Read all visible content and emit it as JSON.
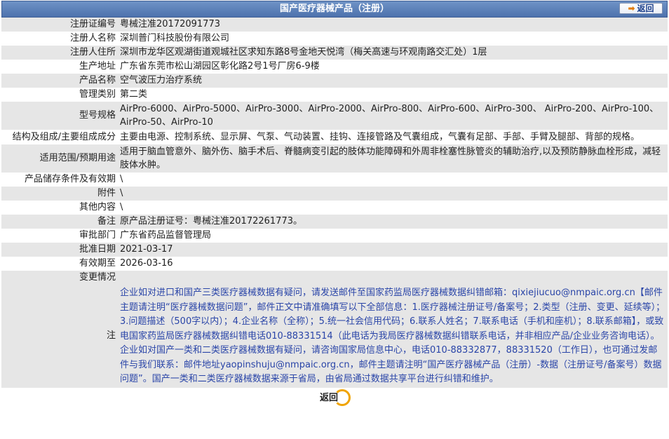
{
  "header": {
    "title": "国产医疗器械产品（注册）",
    "back_label": "返回"
  },
  "rows": [
    {
      "label": "注册证编号",
      "value": "粤械注准20172091773"
    },
    {
      "label": "注册人名称",
      "value": "深圳普门科技股份有限公司"
    },
    {
      "label": "注册人住所",
      "value": "深圳市龙华区观湖街道观城社区求知东路8号金地天悦湾（梅关高速与环观南路交汇处）1层"
    },
    {
      "label": "生产地址",
      "value": "广东省东莞市松山湖园区彰化路2号1号厂房6-9楼"
    },
    {
      "label": "产品名称",
      "value": "空气波压力治疗系统"
    },
    {
      "label": "管理类别",
      "value": "第二类"
    },
    {
      "label": "型号规格",
      "value": "AirPro-6000、AirPro-5000、AirPro-3000、AirPro-2000、AirPro-800、AirPro-600、AirPro-300、 AirPro-200、AirPro-100、AirPro-50、AirPro-10"
    },
    {
      "label": "结构及组成/主要组成成分",
      "value": "主要由电源、控制系统、显示屏、气泵、气动装置、挂钩、连接管路及气囊组成，气囊有足部、手部、手臂及腿部、背部的规格。"
    },
    {
      "label": "适用范围/预期用途",
      "value": "适用于脑血管意外、脑外伤、脑手术后、脊髓病变引起的肢体功能障碍和外周非栓塞性脉管炎的辅助治疗,以及预防静脉血栓形成，减轻肢体水肿。"
    },
    {
      "label": "产品储存条件及有效期",
      "value": "\\"
    },
    {
      "label": "附件",
      "value": "\\"
    },
    {
      "label": "其他内容",
      "value": "\\"
    },
    {
      "label": "备注",
      "value": "原产品注册证号：粤械注准20172261773。"
    },
    {
      "label": "审批部门",
      "value": "广东省药品监督管理局"
    },
    {
      "label": "批准日期",
      "value": "2021-03-17"
    },
    {
      "label": "有效期至",
      "value": "2026-03-16"
    },
    {
      "label": "变更情况",
      "value": ""
    }
  ],
  "note": {
    "label": "注",
    "text": "企业如对进口和国产三类医疗器械数据有疑问，请发送邮件至国家药监局医疗器械数据纠错邮箱：qixiejiucuo@nmpaic.org.cn【邮件主题请注明“医疗器械数据问题”，邮件正文中请准确填写以下全部信息：1.医疗器械注册证号/备案号；2.类型（注册、变更、延续等）；3.问题描述（500字以内）；4.企业名称（全称）；5.统一社会信用代码；6.联系人姓名；7.联系电话（手机和座机）；8.联系邮箱】，或致电国家药监局医疗器械数据纠错电话010-88331514（此电话为我局医疗器械数据纠错联系电话，并非相应产品/企业业务咨询电话）。企业如对国产一类和二类医疗器械数据有疑问，请咨询国家局信息中心，电话010-88332877，88331520（工作日），也可通过发邮件与我们联系：邮件地址yaopinshuju@nmpaic.org.cn，邮件主题请注明“国产医疗器械产品（注册）-数据（注册证号/备案号）数据问题”。国产一类和二类医疗器械数据来源于省局，由省局通过数据共享平台进行纠错和维护。"
  },
  "footer": {
    "back_label": "返回"
  },
  "colors": {
    "header_bg": "#5a7fb8",
    "row_alt_bg": "#e6e6e6",
    "note_text": "#2a45a8",
    "back_ring": "#f0a400"
  }
}
